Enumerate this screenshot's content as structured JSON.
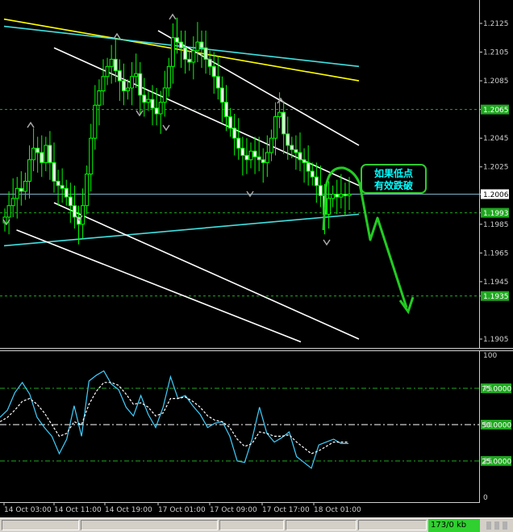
{
  "chart_data": [
    {
      "type": "candlestick",
      "title": "",
      "xlabel": "",
      "ylabel": "",
      "ylim": [
        1.189,
        1.213
      ],
      "y_ticks": [
        "1.2125",
        "1.2105",
        "1.2085",
        "1.2065",
        "1.2045",
        "1.2025",
        "1.2006",
        "1.1993",
        "1.1985",
        "1.1965",
        "1.1945",
        "1.1935",
        "1.1905"
      ],
      "x_tick_labels": [
        "14 Oct 03:00",
        "14 Oct 11:00",
        "14 Oct 19:00",
        "17 Oct 01:00",
        "17 Oct 09:00",
        "17 Oct 17:00",
        "18 Oct 01:00"
      ],
      "price_labels": [
        {
          "name": "horizontal-level-top",
          "value": "1.2065",
          "color": "#29ff29"
        },
        {
          "name": "current-price",
          "value": "1.2006",
          "color": "#ffffff"
        },
        {
          "name": "horizontal-level-mid",
          "value": "1.1993",
          "color": "#29ff29"
        },
        {
          "name": "horizontal-level-low",
          "value": "1.1935",
          "color": "#29ff29"
        }
      ],
      "candles_close": [
        1.199,
        1.1998,
        1.2003,
        1.201,
        1.2008,
        1.2015,
        1.203,
        1.2038,
        1.2035,
        1.2028,
        1.204,
        1.2028,
        1.2015,
        1.2012,
        1.201,
        1.2004,
        1.1998,
        1.199,
        1.1985,
        1.1998,
        1.202,
        1.2045,
        1.2068,
        1.2078,
        1.2088,
        1.2095,
        1.21,
        1.2092,
        1.2085,
        1.2078,
        1.208,
        1.2088,
        1.209,
        1.2075,
        1.207,
        1.2072,
        1.2066,
        1.2062,
        1.207,
        1.208,
        1.2095,
        1.2115,
        1.2112,
        1.2108,
        1.21,
        1.2098,
        1.2106,
        1.2112,
        1.2108,
        1.21,
        1.2095,
        1.2088,
        1.208,
        1.207,
        1.206,
        1.2052,
        1.2045,
        1.2038,
        1.2033,
        1.203,
        1.2036,
        1.2032,
        1.203,
        1.2028,
        1.2035,
        1.2045,
        1.206,
        1.2063,
        1.2048,
        1.204,
        1.2037,
        1.2035,
        1.203,
        1.2028,
        1.2022,
        1.2018,
        1.2012,
        1.2005,
        1.1992,
        1.2003,
        1.2006,
        1.2004,
        1.2006,
        1.2005,
        1.2006
      ],
      "trendlines": [
        {
          "name": "yellow-line",
          "color": "#ffff00",
          "from": [
            "14 Oct 03:00",
            1.2128
          ],
          "to": [
            "18 Oct 08:00",
            1.2085
          ]
        },
        {
          "name": "cyan-upper-line",
          "color": "#40e0e0",
          "from": [
            "14 Oct 03:00",
            1.2123
          ],
          "to": [
            "18 Oct 08:00",
            1.2095
          ]
        },
        {
          "name": "cyan-lower-line",
          "color": "#40e0e0",
          "from": [
            "14 Oct 03:00",
            1.197
          ],
          "to": [
            "18 Oct 08:00",
            1.1992
          ]
        },
        {
          "name": "channel-upper",
          "color": "#ffffff",
          "from": [
            "17 Oct 01:00",
            1.212
          ],
          "to": [
            "18 Oct 08:00",
            1.204
          ]
        },
        {
          "name": "channel-mid",
          "color": "#ffffff",
          "from": [
            "14 Oct 11:00",
            1.2108
          ],
          "to": [
            "18 Oct 08:00",
            1.2012
          ]
        },
        {
          "name": "channel-lower",
          "color": "#ffffff",
          "from": [
            "14 Oct 11:00",
            1.2
          ],
          "to": [
            "18 Oct 08:00",
            1.1905
          ]
        },
        {
          "name": "channel-lowest",
          "color": "#ffffff",
          "from": [
            "14 Oct 05:00",
            1.1981
          ],
          "to": [
            "17 Oct 23:00",
            1.1903
          ]
        }
      ],
      "annotation": {
        "text_line1": "如果低点",
        "text_line2": "有效跌破",
        "color": "#00ffff",
        "border": "#2ecc2e"
      }
    },
    {
      "type": "line",
      "ylim": [
        0,
        100
      ],
      "y_ticks": [
        "100",
        "75",
        "50",
        "25",
        "0"
      ],
      "levels": [
        {
          "value": 75,
          "label": "75.0000"
        },
        {
          "value": 50,
          "label": "50.0000"
        },
        {
          "value": 25,
          "label": "25.0000"
        }
      ],
      "series": [
        {
          "color": "#40d0ff",
          "style": "solid",
          "values": [
            55,
            60,
            72,
            79,
            71,
            55,
            48,
            42,
            30,
            40,
            63,
            42,
            80,
            84,
            87,
            78,
            74,
            62,
            56,
            70,
            57,
            48,
            62,
            83,
            68,
            70,
            63,
            57,
            48,
            51,
            52,
            42,
            25,
            24,
            40,
            62,
            44,
            38,
            41,
            45,
            28,
            24,
            20,
            36,
            38,
            40,
            37,
            37
          ]
        },
        {
          "color": "#ffffff",
          "style": "dashed",
          "values": [
            52,
            55,
            60,
            66,
            68,
            64,
            58,
            50,
            42,
            44,
            52,
            50,
            64,
            73,
            79,
            79,
            77,
            71,
            64,
            65,
            62,
            56,
            58,
            68,
            68,
            69,
            66,
            62,
            56,
            53,
            52,
            48,
            40,
            35,
            37,
            45,
            44,
            42,
            42,
            43,
            38,
            34,
            30,
            32,
            35,
            38,
            38,
            38
          ]
        }
      ]
    }
  ]
}
